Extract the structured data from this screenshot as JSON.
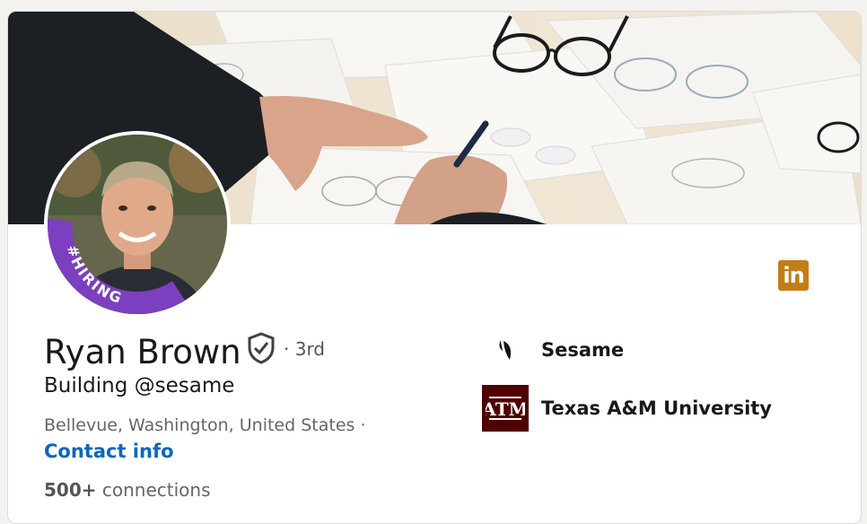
{
  "profile": {
    "name": "Ryan Brown",
    "degree": "· 3rd",
    "headline": "Building @sesame",
    "location": "Bellevue, Washington, United States ·",
    "contact_label": "Contact info",
    "connections_count": "500+",
    "connections_label": "connections",
    "frame_badge": "#HIRING"
  },
  "organizations": [
    {
      "name": "Sesame",
      "icon": "sesame-logo-icon"
    },
    {
      "name": "Texas A&M University",
      "icon": "texas-am-logo-icon"
    }
  ],
  "colors": {
    "link": "#0a66c2",
    "hiring_frame": "#7b3fbf",
    "linkedin_badge": "#c37d16",
    "tamu_maroon": "#500000"
  }
}
